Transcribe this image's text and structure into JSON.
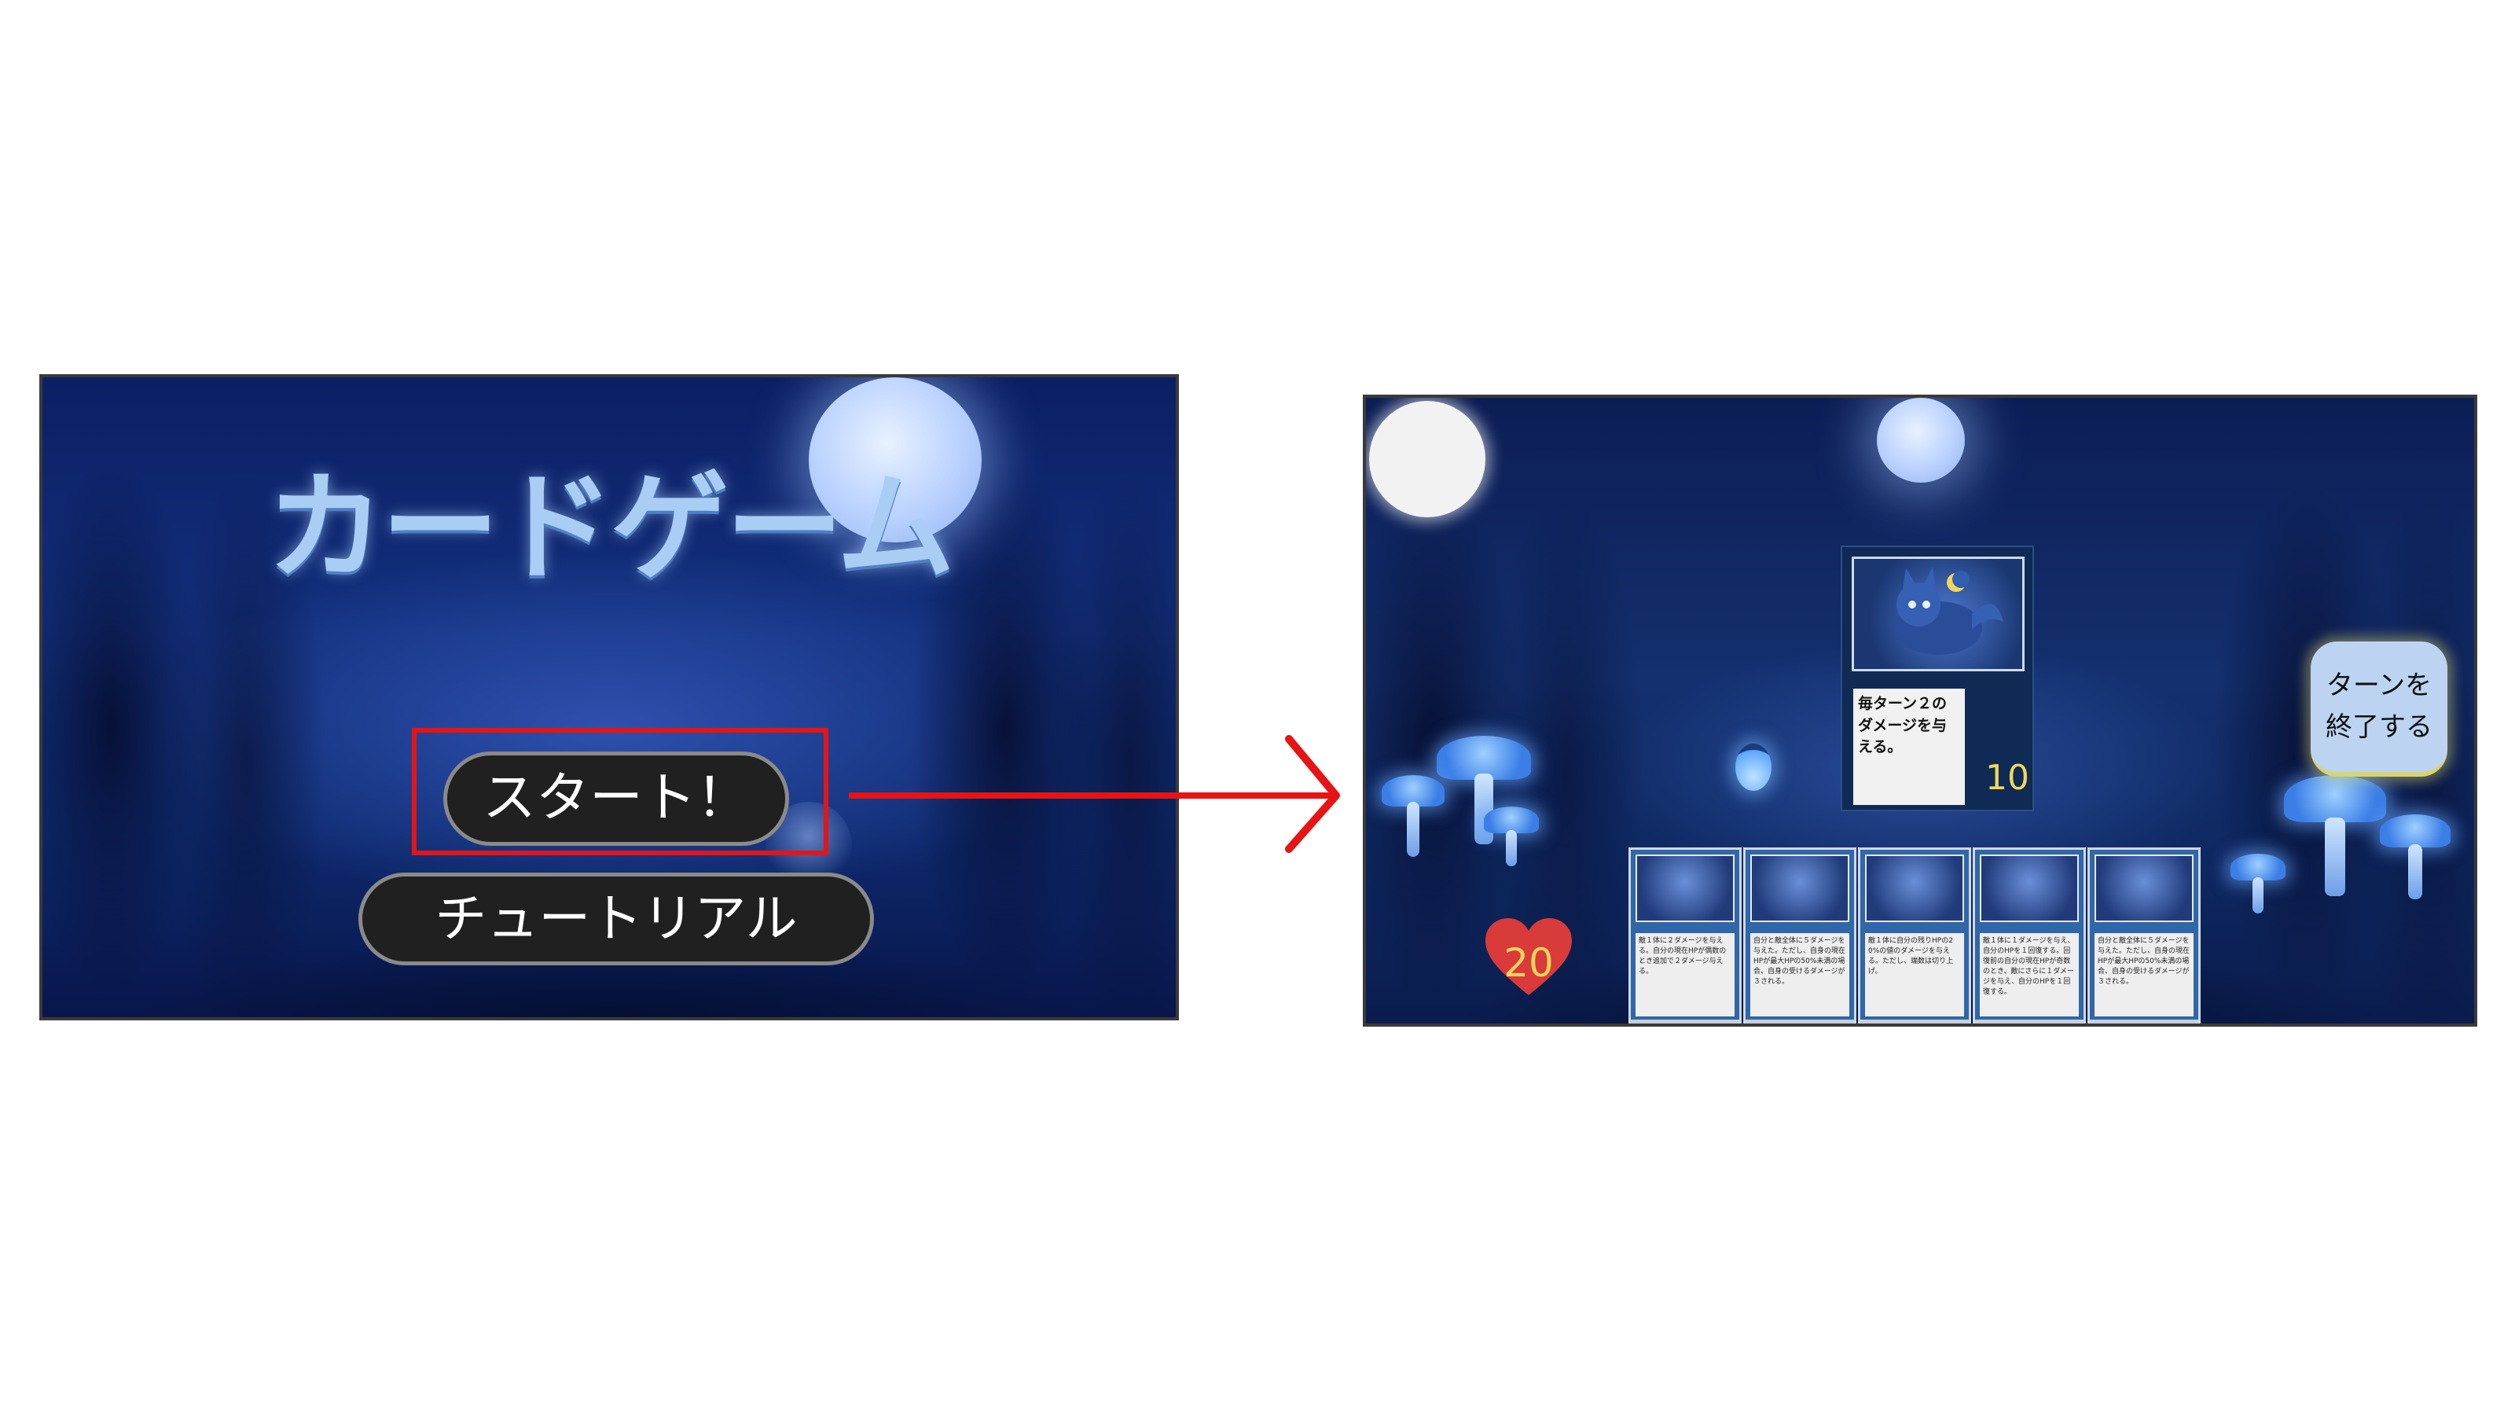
{
  "title_screen": {
    "game_title": "カードゲーム",
    "start_label": "スタート！",
    "tutorial_label": "チュートリアル"
  },
  "game_screen": {
    "enemy": {
      "description": "毎ターン２のダメージを与える。",
      "hp": "10"
    },
    "end_turn_label": "ターンを終了する",
    "player_hp": "20",
    "hand": [
      {
        "text": "敵１体に２ダメージを与える。自分の現在HPが偶数のとき追加で２ダメージ与える。",
        "icon": "fire-mage-icon"
      },
      {
        "text": "自分と敵全体に５ダメージを与えた。ただし、自身の現在HPが最大HPの50%未満の場合、自身の受けるダメージが３される。",
        "icon": "witch-icon"
      },
      {
        "text": "敵１体に自分の残りHPの20%の値のダメージを与える。ただし、端数は切り上げ。",
        "icon": "moon-witch-icon"
      },
      {
        "text": "敵１体に１ダメージを与え、自分のHPを１回復する。回復前の自分の現在HPが奇数のとき、敵にさらに１ダメージを与え、自分のHPを１回復する。",
        "icon": "boy-mage-icon"
      },
      {
        "text": "自分と敵全体に５ダメージを与えた。ただし、自身の現在HPが最大HPの50%未満の場合、自身の受けるダメージが３される。",
        "icon": "witch-icon"
      }
    ]
  },
  "colors": {
    "highlight": "#e61414",
    "arrow": "#e61414",
    "hp_text": "#f3d45a"
  }
}
